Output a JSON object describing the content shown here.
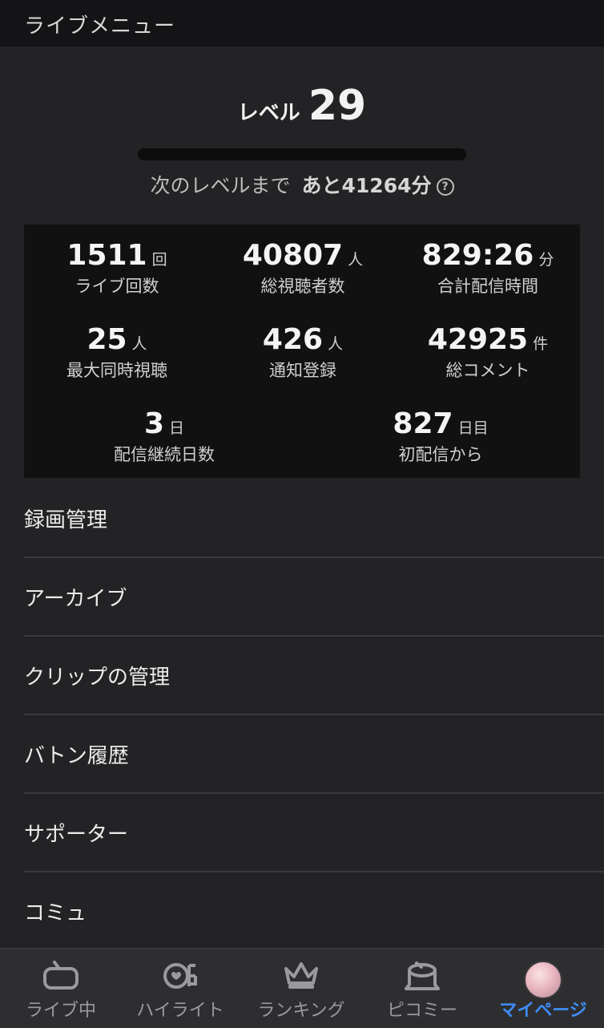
{
  "header": {
    "title": "ライブメニュー"
  },
  "level": {
    "label": "レベル",
    "value": "29",
    "progress": 0,
    "next_prefix": "次のレベルまで",
    "next_remaining": "あと41264分",
    "help_icon": "question-circle-icon"
  },
  "stats": {
    "live_count": {
      "value": "1511",
      "unit": "回",
      "label": "ライブ回数"
    },
    "total_viewers": {
      "value": "40807",
      "unit": "人",
      "label": "総視聴者数"
    },
    "total_time": {
      "value": "829:26",
      "unit": "分",
      "label": "合計配信時間"
    },
    "max_concurrent": {
      "value": "25",
      "unit": "人",
      "label": "最大同時視聴"
    },
    "notification_signups": {
      "value": "426",
      "unit": "人",
      "label": "通知登録"
    },
    "total_comments": {
      "value": "42925",
      "unit": "件",
      "label": "総コメント"
    },
    "streak_days": {
      "value": "3",
      "unit": "日",
      "label": "配信継続日数"
    },
    "since_first": {
      "value": "827",
      "unit": "日目",
      "label": "初配信から"
    }
  },
  "menu": {
    "items": [
      {
        "label": "録画管理"
      },
      {
        "label": "アーカイブ"
      },
      {
        "label": "クリップの管理"
      },
      {
        "label": "バトン履歴"
      },
      {
        "label": "サポーター"
      },
      {
        "label": "コミュ"
      }
    ]
  },
  "tabbar": {
    "tabs": [
      {
        "label": "ライブ中",
        "icon": "tv-icon"
      },
      {
        "label": "ハイライト",
        "icon": "highlight-icon"
      },
      {
        "label": "ランキング",
        "icon": "crown-icon"
      },
      {
        "label": "ピコミー",
        "icon": "tree-stump-icon"
      },
      {
        "label": "マイページ",
        "icon": "avatar"
      }
    ],
    "active_index": 4,
    "active_color": "#3f8cf5",
    "inactive_color": "#9a9a9e"
  }
}
